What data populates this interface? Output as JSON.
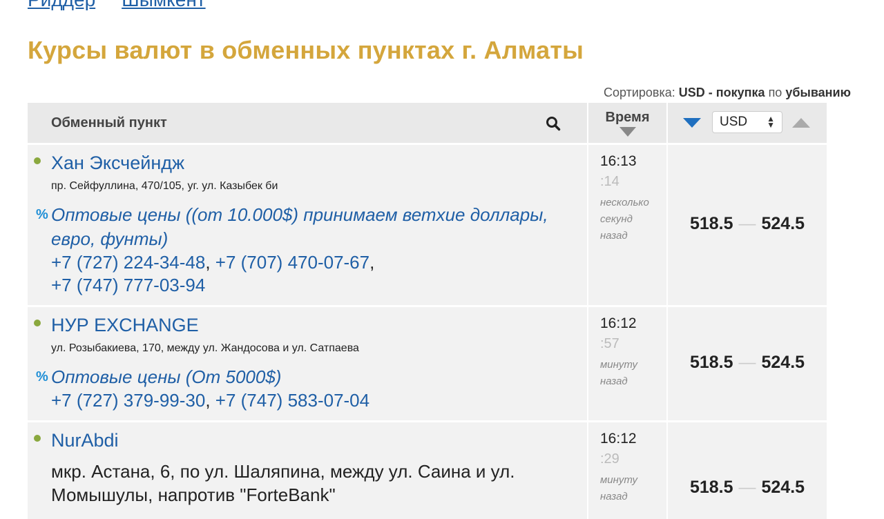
{
  "cities": [
    "Риддер",
    "Шымкент"
  ],
  "title": "Курсы валют в обменных пунктах г. Алматы",
  "sort": {
    "label": "Сортировка:",
    "field": "USD - покупка",
    "by": "по",
    "direction": "убыванию"
  },
  "header": {
    "point": "Обменный пункт",
    "time": "Время",
    "currency": "USD",
    "search_icon": "search-icon",
    "sort_desc_icon": "triangle-down-icon",
    "sort_asc_icon": "triangle-up-icon"
  },
  "rows": [
    {
      "name": "Хан Эксчейндж",
      "address": "пр. Сейфуллина, 470/105, уг. ул. Казыбек би",
      "promo": "Оптовые цены ((от 10.000$) принимаем ветхие доллары, евро, фунты)",
      "phones": [
        "+7 (727) 224-34-48",
        "+7 (707) 470-07-67",
        "+7 (747) 777-03-94"
      ],
      "time": "16:13",
      "seconds": ":14",
      "ago": [
        "несколько",
        "секунд",
        "назад"
      ],
      "buy": "518.5",
      "sell": "524.5"
    },
    {
      "name": "НУР EXCHANGE",
      "address": "ул. Розыбакиева, 170, между ул. Жандосова и ул. Сатпаева",
      "promo": "Оптовые цены (От 5000$)",
      "phones": [
        "+7 (727) 379-99-30",
        "+7 (747) 583-07-04"
      ],
      "time": "16:12",
      "seconds": ":57",
      "ago": [
        "минуту",
        "назад"
      ],
      "buy": "518.5",
      "sell": "524.5"
    },
    {
      "name": "NurAbdi",
      "address": "мкр. Астана, 6, по ул. Шаляпина, между ул. Саина и ул. Момышулы, напротив \"ForteBank\"",
      "time": "16:12",
      "seconds": ":29",
      "ago": [
        "минуту",
        "назад"
      ],
      "buy": "518.5",
      "sell": "524.5"
    }
  ],
  "colors": {
    "title": "#d4a63c",
    "link": "#1f5fa6",
    "status_dot": "#8aa83e",
    "sort_active": "#1f6fbf"
  }
}
